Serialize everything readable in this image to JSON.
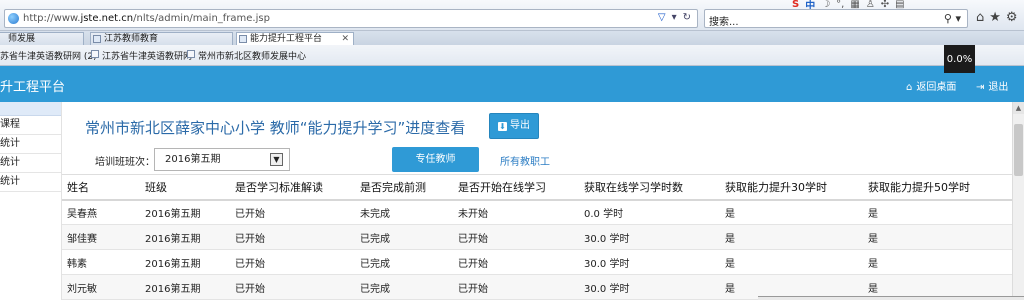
{
  "browser": {
    "url_prefix": "http://www.",
    "url_host": "jste.net.cn",
    "url_path": "/nlts/admin/main_frame.jsp",
    "search_placeholder": "搜索...",
    "tabs": [
      "师发展",
      "江苏教师教育",
      "能力提升工程平台"
    ],
    "favorites": [
      "苏省牛津英语教研网 (2)",
      "江苏省牛津英语教研网",
      "常州市新北区教师发展中心"
    ],
    "progress": "0.0%"
  },
  "header": {
    "title": "升工程平台",
    "back_desktop": "返回桌面",
    "logout": "退出"
  },
  "sidebar": {
    "items": [
      "课程",
      "统计",
      "统计",
      "统计"
    ]
  },
  "main": {
    "title": "常州市新北区薛家中心小学 教师“能力提升学习”进度查看",
    "export_label": "导出",
    "class_label": "培训班班次：",
    "class_value": "2016第五期",
    "btn_teacher": "专任教师",
    "link_all": "所有教职工",
    "columns": [
      "姓名",
      "班级",
      "是否学习标准解读",
      "是否完成前测",
      "是否开始在线学习",
      "获取在线学习学时数",
      "获取能力提升30学时",
      "获取能力提升50学时"
    ],
    "rows": [
      [
        "吴春燕",
        "2016第五期",
        "已开始",
        "未完成",
        "未开始",
        "0.0 学时",
        "是",
        "是"
      ],
      [
        "邹佳赛",
        "2016第五期",
        "已开始",
        "已完成",
        "已开始",
        "30.0 学时",
        "是",
        "是"
      ],
      [
        "韩素",
        "2016第五期",
        "已开始",
        "已完成",
        "已开始",
        "30.0 学时",
        "是",
        "是"
      ],
      [
        "刘元敏",
        "2016第五期",
        "已开始",
        "已完成",
        "已开始",
        "30.0 学时",
        "是",
        "是"
      ]
    ]
  },
  "colors": {
    "header_bg": "#2f9ad6",
    "title_blue": "#2b6aa8",
    "link_blue": "#2d7ec4",
    "status_green": "#3a9c2e"
  }
}
